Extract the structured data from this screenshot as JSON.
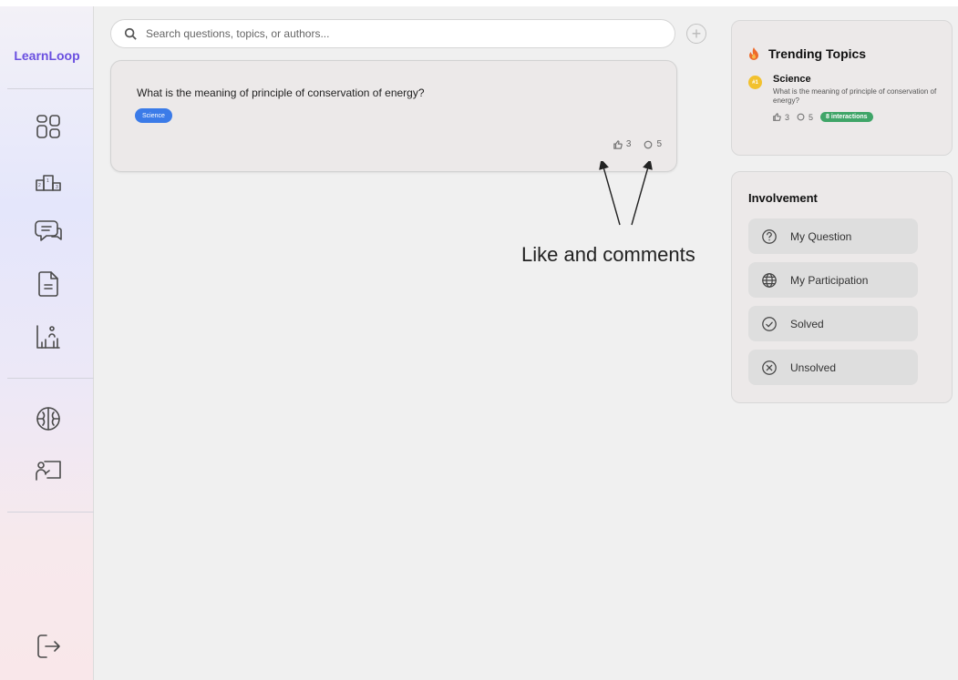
{
  "app": {
    "name": "LearnLoop"
  },
  "sidebar": {
    "items": [
      {
        "icon": "dashboard-icon"
      },
      {
        "icon": "leaderboard-icon"
      },
      {
        "icon": "discussion-icon"
      },
      {
        "icon": "document-icon"
      },
      {
        "icon": "analytics-icon"
      },
      {
        "icon": "brain-icon"
      },
      {
        "icon": "classroom-icon"
      }
    ],
    "logout_icon": "logout-icon"
  },
  "search": {
    "placeholder": "Search questions, topics, or authors...",
    "value": ""
  },
  "add_button": {
    "icon": "plus-circle-icon"
  },
  "question": {
    "title": "What is the meaning of principle of conservation of energy?",
    "tag": "Science",
    "likes": "3",
    "comments": "5"
  },
  "annotation": {
    "text": "Like and comments"
  },
  "trending": {
    "title": "Trending Topics",
    "items": [
      {
        "rank": "#1",
        "topic": "Science",
        "description": "What is the meaning of principle of conservation of energy?",
        "likes": "3",
        "comments": "5",
        "interactions": "8 interactions"
      }
    ]
  },
  "involvement": {
    "title": "Involvement",
    "buttons": [
      {
        "label": "My Question",
        "icon": "question-circle-icon"
      },
      {
        "label": "My Participation",
        "icon": "globe-icon"
      },
      {
        "label": "Solved",
        "icon": "check-circle-icon"
      },
      {
        "label": "Unsolved",
        "icon": "x-circle-icon"
      }
    ]
  },
  "colors": {
    "brand": "#6a4fe0",
    "tag": "#3b7be8",
    "badge": "#3fa568",
    "rank": "#f2c12e"
  }
}
